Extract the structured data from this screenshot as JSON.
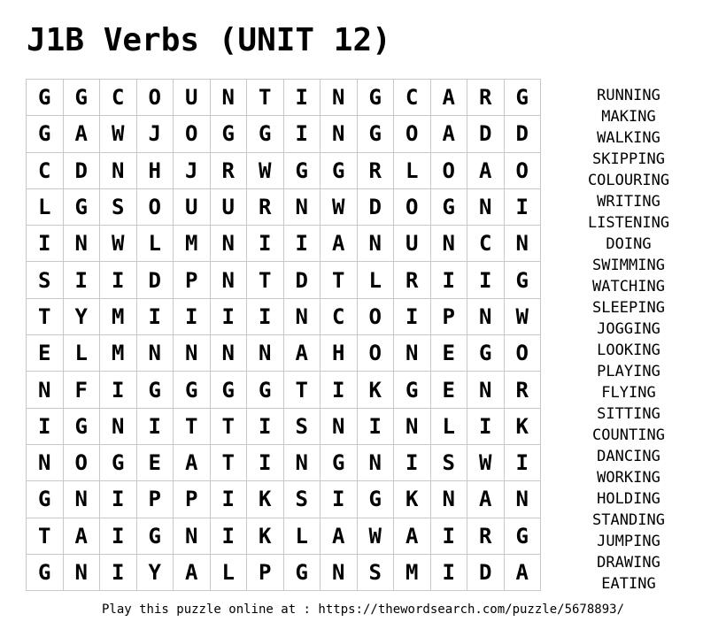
{
  "title": "J1B Verbs (UNIT 12)",
  "grid": [
    [
      "G",
      "G",
      "C",
      "O",
      "U",
      "N",
      "T",
      "I",
      "N",
      "G",
      "C",
      "A",
      "R",
      "G"
    ],
    [
      "G",
      "A",
      "W",
      "J",
      "O",
      "G",
      "G",
      "I",
      "N",
      "G",
      "O",
      "A",
      "D",
      "D"
    ],
    [
      "C",
      "D",
      "N",
      "H",
      "J",
      "R",
      "W",
      "G",
      "G",
      "R",
      "L",
      "O",
      "A",
      "O"
    ],
    [
      "L",
      "G",
      "S",
      "O",
      "U",
      "U",
      "R",
      "N",
      "W",
      "D",
      "O",
      "G",
      "N",
      "I"
    ],
    [
      "I",
      "N",
      "W",
      "L",
      "M",
      "N",
      "I",
      "I",
      "A",
      "N",
      "U",
      "N",
      "C",
      "N"
    ],
    [
      "S",
      "I",
      "I",
      "D",
      "P",
      "N",
      "T",
      "D",
      "T",
      "L",
      "R",
      "I",
      "I",
      "G"
    ],
    [
      "T",
      "Y",
      "M",
      "I",
      "I",
      "I",
      "I",
      "N",
      "C",
      "O",
      "I",
      "P",
      "N",
      "W"
    ],
    [
      "E",
      "L",
      "M",
      "N",
      "N",
      "N",
      "N",
      "A",
      "H",
      "O",
      "N",
      "E",
      "G",
      "O"
    ],
    [
      "N",
      "F",
      "I",
      "G",
      "G",
      "G",
      "G",
      "T",
      "I",
      "K",
      "G",
      "E",
      "N",
      "R"
    ],
    [
      "I",
      "G",
      "N",
      "I",
      "T",
      "T",
      "I",
      "S",
      "N",
      "I",
      "N",
      "L",
      "I",
      "K"
    ],
    [
      "N",
      "O",
      "G",
      "E",
      "A",
      "T",
      "I",
      "N",
      "G",
      "N",
      "I",
      "S",
      "W",
      "I"
    ],
    [
      "G",
      "N",
      "I",
      "P",
      "P",
      "I",
      "K",
      "S",
      "I",
      "G",
      "K",
      "N",
      "A",
      "N"
    ],
    [
      "T",
      "A",
      "I",
      "G",
      "N",
      "I",
      "K",
      "L",
      "A",
      "W",
      "A",
      "I",
      "R",
      "G"
    ],
    [
      "G",
      "N",
      "I",
      "Y",
      "A",
      "L",
      "P",
      "G",
      "N",
      "S",
      "M",
      "I",
      "D",
      "A"
    ]
  ],
  "words": [
    "RUNNING",
    "MAKING",
    "WALKING",
    "SKIPPING",
    "COLOURING",
    "WRITING",
    "LISTENING",
    "DOING",
    "SWIMMING",
    "WATCHING",
    "SLEEPING",
    "JOGGING",
    "LOOKING",
    "PLAYING",
    "FLYING",
    "SITTING",
    "COUNTING",
    "DANCING",
    "WORKING",
    "HOLDING",
    "STANDING",
    "JUMPING",
    "DRAWING",
    "EATING"
  ],
  "footer": "Play this puzzle online at : https://thewordsearch.com/puzzle/5678893/"
}
